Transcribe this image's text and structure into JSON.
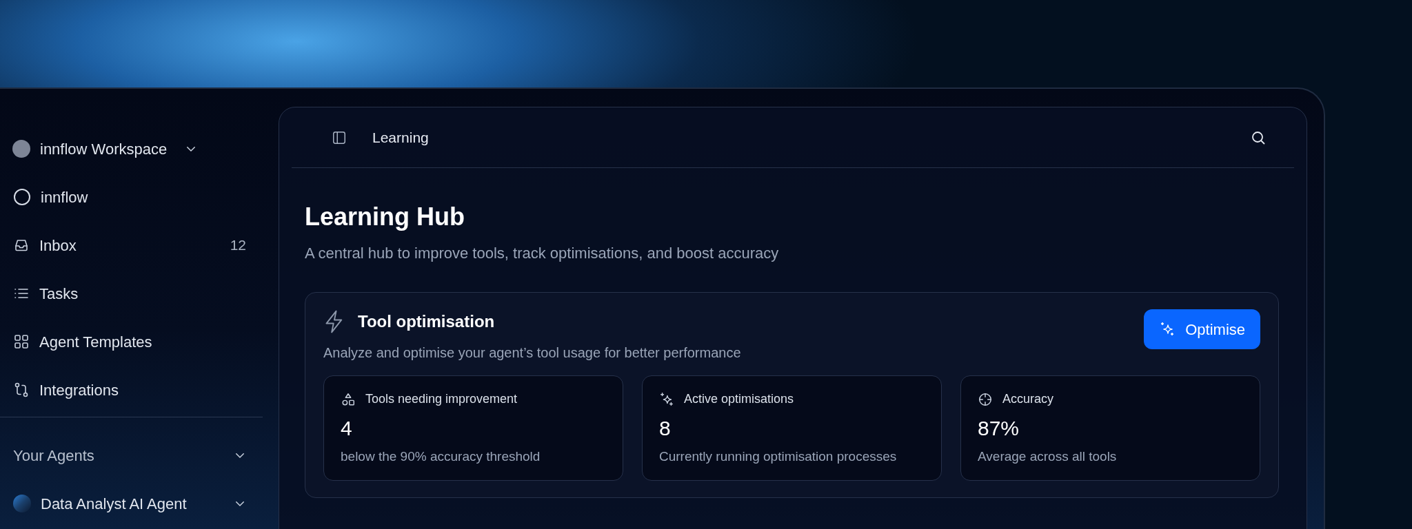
{
  "workspace": {
    "name": "innflow Workspace"
  },
  "sidebar": {
    "items": [
      {
        "kind": "org",
        "label": "innflow"
      },
      {
        "kind": "inbox",
        "label": "Inbox",
        "count": "12"
      },
      {
        "kind": "tasks",
        "label": "Tasks"
      },
      {
        "kind": "templates",
        "label": "Agent Templates"
      },
      {
        "kind": "integrations",
        "label": "Integrations"
      }
    ],
    "sections": [
      {
        "kind": "header",
        "label": "Your Agents"
      },
      {
        "kind": "agent",
        "label": "Data Analyst AI Agent"
      }
    ]
  },
  "header": {
    "title": "Learning"
  },
  "page": {
    "title": "Learning Hub",
    "subtitle": "A central hub to improve tools, track optimisations, and boost accuracy"
  },
  "card": {
    "title": "Tool optimisation",
    "subtitle": "Analyze and optimise your agent’s tool usage for better performance",
    "button": "Optimise",
    "stats": [
      {
        "kind": "shapes",
        "label": "Tools needing improvement",
        "value": "4",
        "note": "below the 90% accuracy threshold"
      },
      {
        "kind": "sparkles",
        "label": "Active optimisations",
        "value": "8",
        "note": "Currently running optimisation processes"
      },
      {
        "kind": "target",
        "label": "Accuracy",
        "value": "87%",
        "note": "Average across all tools"
      }
    ]
  }
}
